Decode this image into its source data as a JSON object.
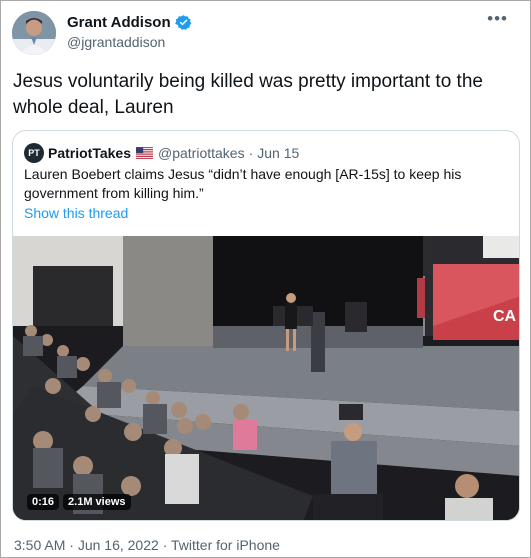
{
  "author": {
    "name": "Grant Addison",
    "handle": "@jgrantaddison",
    "verified_color": "#1d9bf0"
  },
  "more_icon": "more-horizontal-icon",
  "tweet": {
    "text": "Jesus voluntarily being killed was pretty important to the whole deal, Lauren"
  },
  "quoted": {
    "avatar_text": "PT",
    "name": "PatriotTakes",
    "flag_icon": "us-flag-icon",
    "handle": "@patriottakes",
    "separator": "·",
    "date": "Jun 15",
    "text": "Lauren Boebert claims Jesus “didn’t have enough [AR-15s] to keep his government from killing him.”",
    "show_thread": "Show this thread",
    "video": {
      "duration": "0:16",
      "views": "2.1M views",
      "screen_text": "CA"
    }
  },
  "footer": {
    "time": "3:50 AM",
    "separator": "·",
    "date": "Jun 16, 2022",
    "separator2": "·",
    "source": "Twitter for iPhone"
  },
  "colors": {
    "link": "#1d9bf0",
    "secondary_text": "#536471",
    "border": "#cfd9de"
  }
}
